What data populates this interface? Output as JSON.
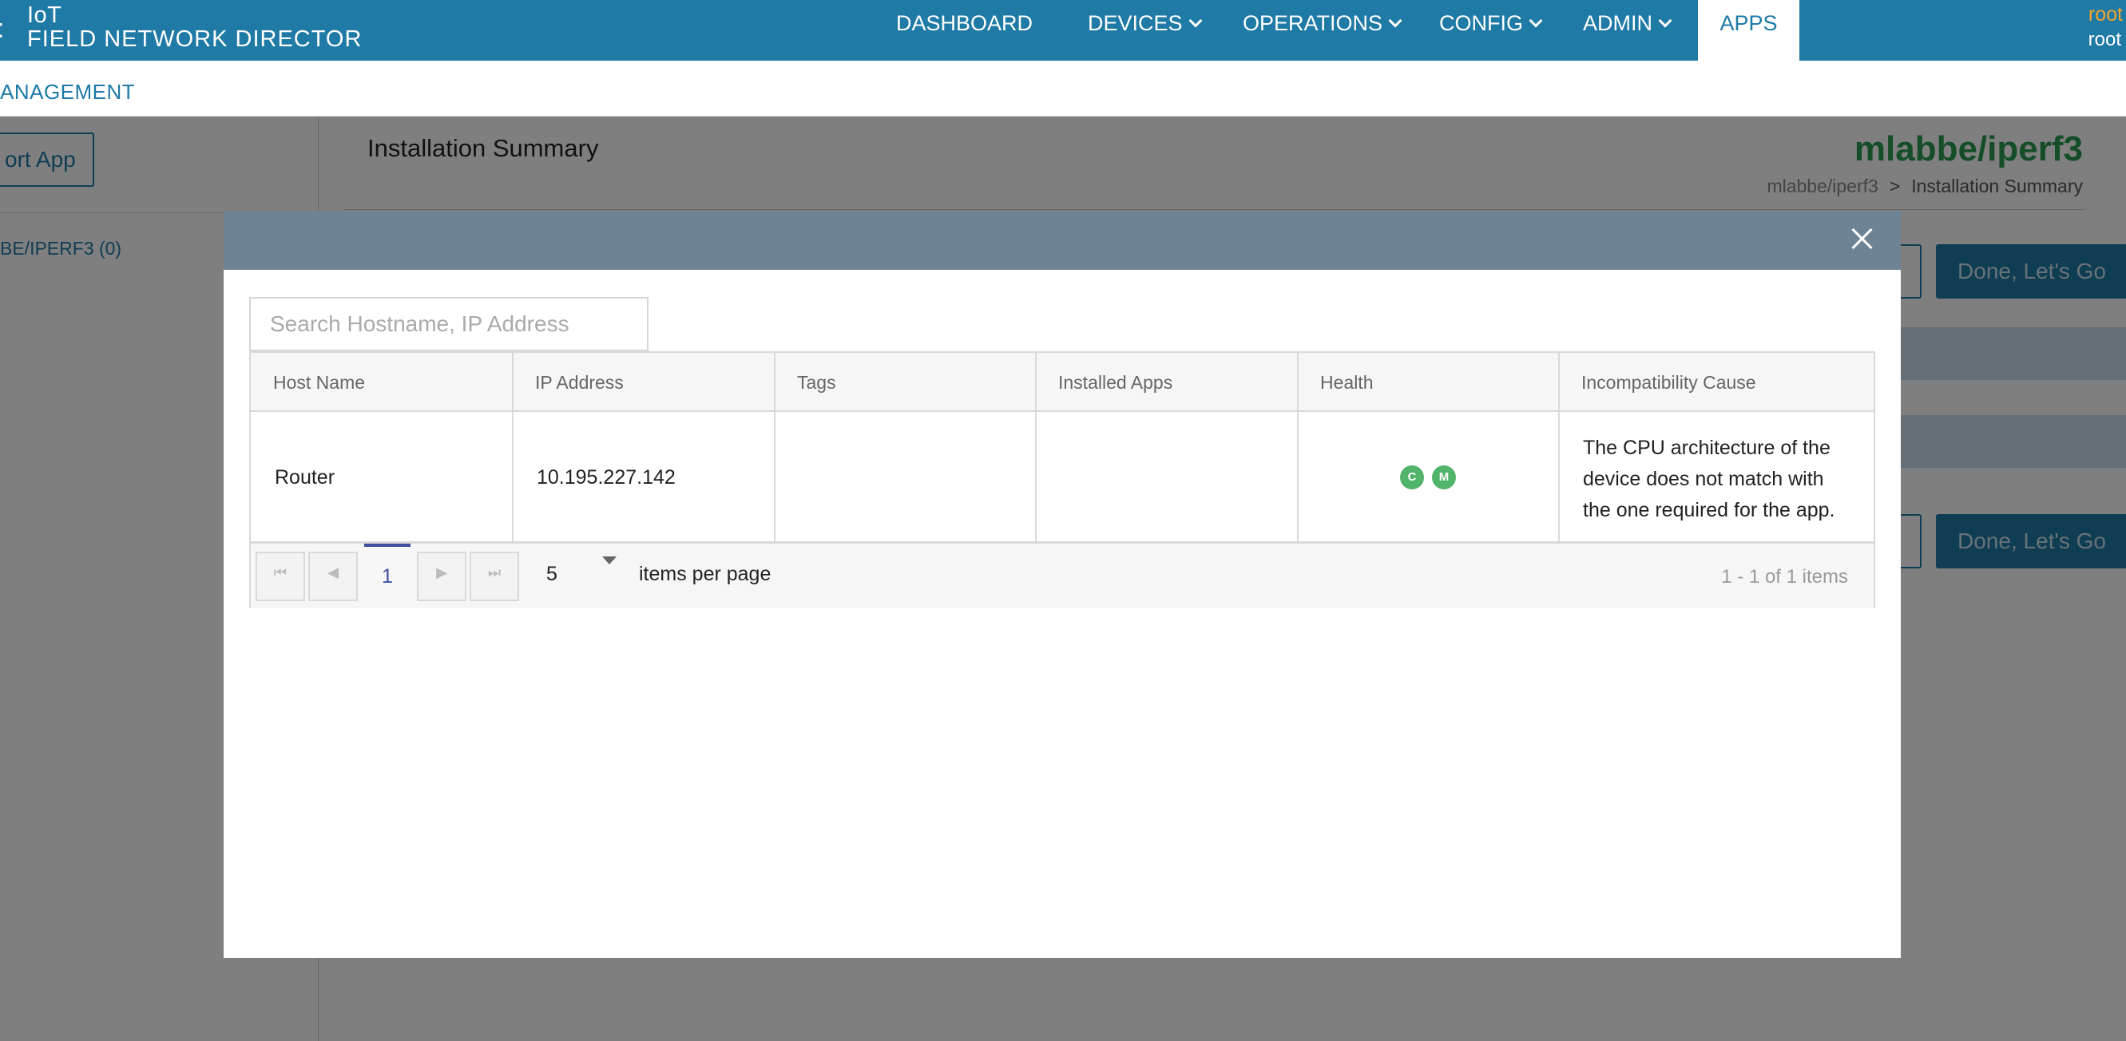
{
  "header": {
    "brand_line1": "IoT",
    "brand_line2": "FIELD NETWORK DIRECTOR",
    "nav": [
      "DASHBOARD",
      "DEVICES",
      "OPERATIONS",
      "CONFIG",
      "ADMIN",
      "APPS"
    ],
    "active_nav": "APPS",
    "user_role": "root",
    "user_name": "root"
  },
  "subnav": {
    "label": "ANAGEMENT"
  },
  "sidebar": {
    "import_button": "ort App",
    "item": "BE/IPERF3 (0)"
  },
  "page": {
    "title": "Installation Summary",
    "app_name": "mlabbe/iperf3",
    "breadcrumb": [
      "mlabbe/iperf3",
      ">",
      "Installation Summary"
    ],
    "done_button": "Done, Let's Go"
  },
  "modal": {
    "search_placeholder": "Search Hostname, IP Address",
    "columns": [
      "Host Name",
      "IP Address",
      "Tags",
      "Installed Apps",
      "Health",
      "Incompatibility Cause"
    ],
    "rows": [
      {
        "host_name": "Router",
        "ip_address": "10.195.227.142",
        "tags": "",
        "installed_apps": "",
        "health": [
          "C",
          "M"
        ],
        "incompatibility_cause": "The CPU architecture of the device does not match with the one required for the app."
      }
    ],
    "pager": {
      "current_page": "1",
      "page_size": "5",
      "page_size_label": "items per page",
      "info": "1 - 1 of 1 items"
    }
  },
  "colors": {
    "nav_bg": "#1f7aa6",
    "modal_header": "#6e8495",
    "health_ok": "#52b36b",
    "app_title": "#2b9a52",
    "user_accent": "#f2a52b"
  }
}
